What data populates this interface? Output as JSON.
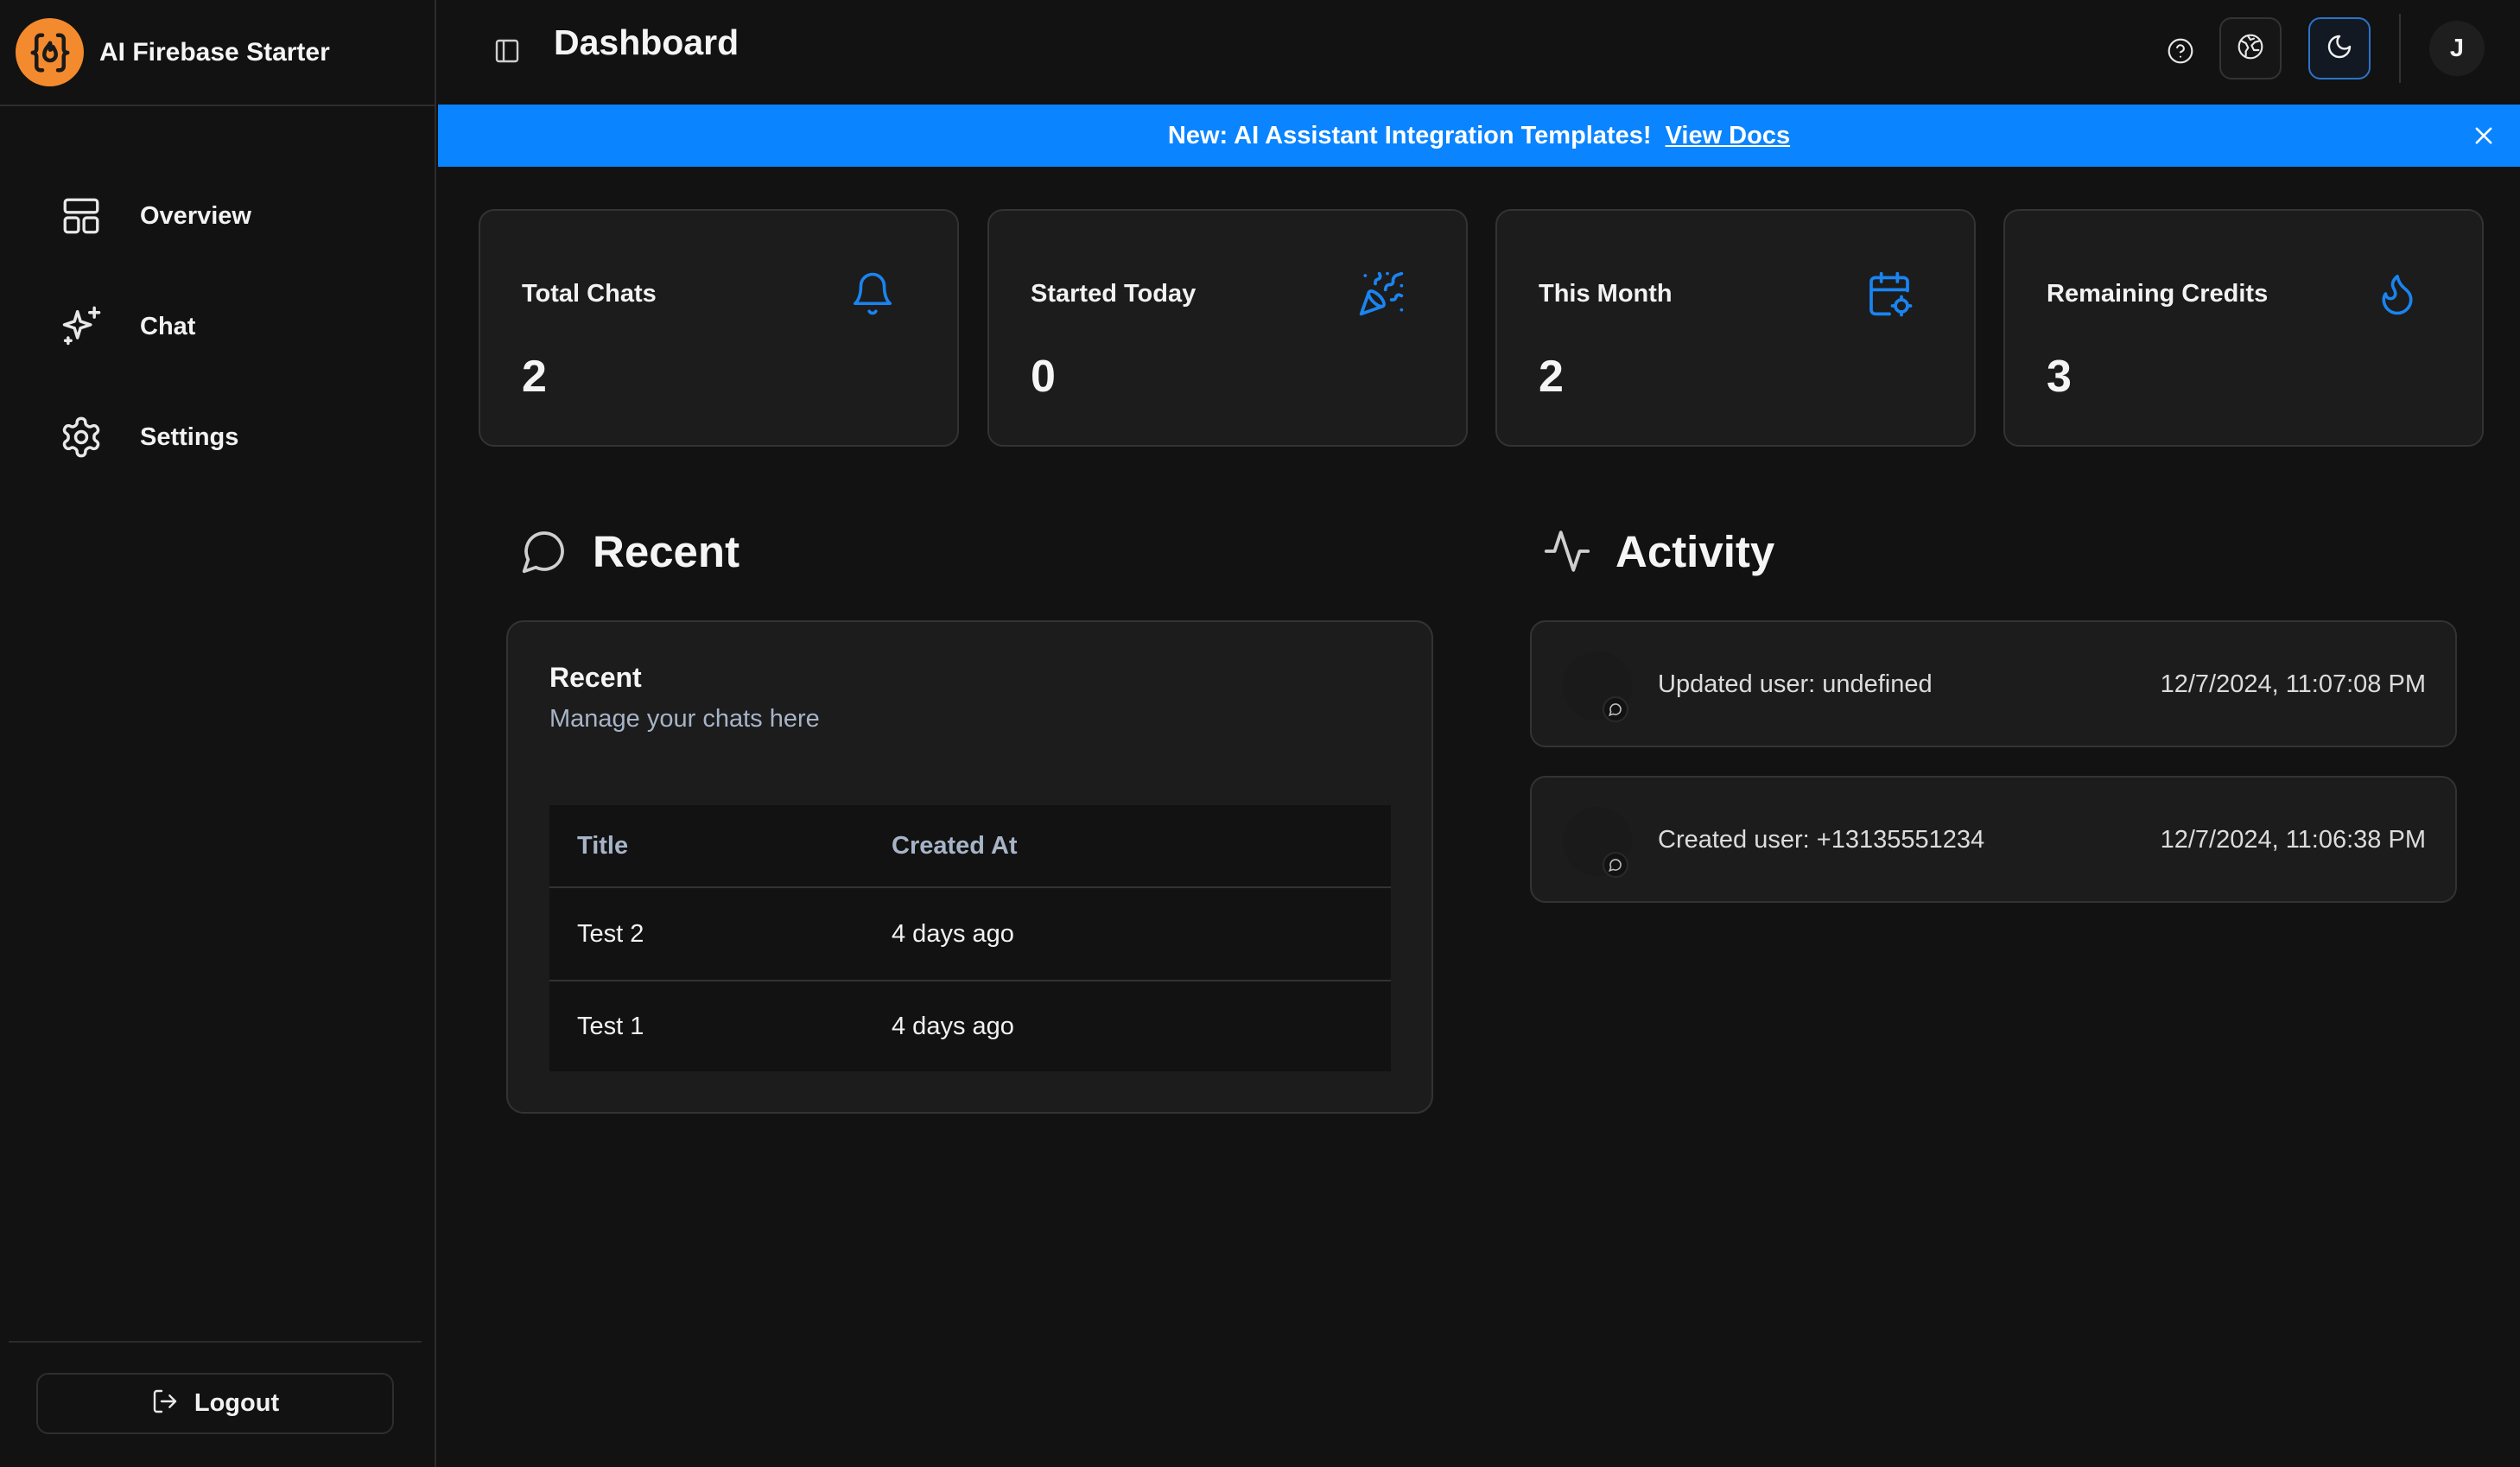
{
  "app": {
    "name": "AI Firebase Starter"
  },
  "sidebar": {
    "items": [
      {
        "label": "Overview",
        "icon": "layout-dashboard-icon"
      },
      {
        "label": "Chat",
        "icon": "sparkles-icon"
      },
      {
        "label": "Settings",
        "icon": "gear-icon"
      }
    ],
    "logout_label": "Logout"
  },
  "header": {
    "title": "Dashboard",
    "avatar_initial": "J"
  },
  "banner": {
    "text": "New: AI Assistant Integration Templates!",
    "link": "View Docs"
  },
  "stats": [
    {
      "label": "Total Chats",
      "value": "2",
      "icon": "bell-icon"
    },
    {
      "label": "Started Today",
      "value": "0",
      "icon": "party-popper-icon"
    },
    {
      "label": "This Month",
      "value": "2",
      "icon": "calendar-cog-icon"
    },
    {
      "label": "Remaining Credits",
      "value": "3",
      "icon": "flame-icon"
    }
  ],
  "recent": {
    "heading": "Recent",
    "card_title": "Recent",
    "card_subtitle": "Manage your chats here",
    "columns": [
      "Title",
      "Created At"
    ],
    "rows": [
      {
        "title": "Test 2",
        "created": "4 days ago"
      },
      {
        "title": "Test 1",
        "created": "4 days ago"
      }
    ]
  },
  "activity": {
    "heading": "Activity",
    "items": [
      {
        "text": "Updated user: undefined",
        "time": "12/7/2024, 11:07:08 PM"
      },
      {
        "text": "Created user: +13135551234",
        "time": "12/7/2024, 11:06:38 PM"
      }
    ]
  },
  "colors": {
    "accent": "#0a84ff",
    "brand": "#f48a2e",
    "background": "#121212",
    "card": "#1c1c1c"
  }
}
